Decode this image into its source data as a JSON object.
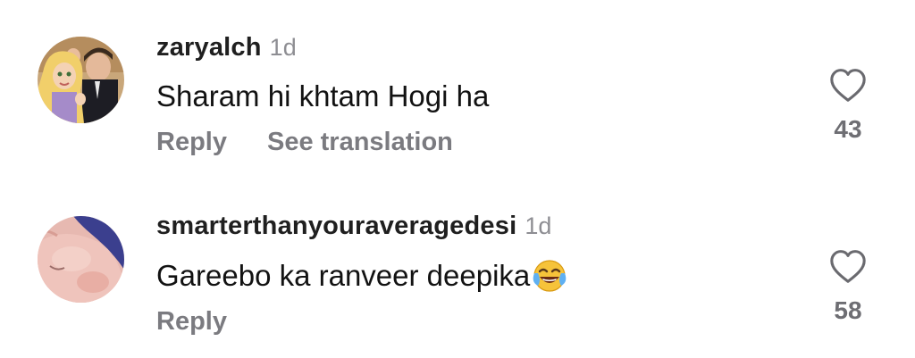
{
  "comments": [
    {
      "username": "zaryalch",
      "time": "1d",
      "text": "Sharam hi khtam Hogi ha",
      "actions": [
        "Reply",
        "See translation"
      ],
      "likes": "43",
      "avatar": "avatar-couple-cartoon"
    },
    {
      "username": "smarterthanyouraveragedesi",
      "time": "1d",
      "text": "Gareebo ka ranveer deepika",
      "emoji": "face-with-tears-of-joy",
      "actions": [
        "Reply"
      ],
      "likes": "58",
      "avatar": "avatar-face-closeup"
    }
  ],
  "icons": {
    "like": "heart-outline-icon"
  },
  "colors": {
    "username": "#1f1f1f",
    "secondary": "#8e8e93",
    "action": "#7b7b80",
    "text": "#121212"
  }
}
